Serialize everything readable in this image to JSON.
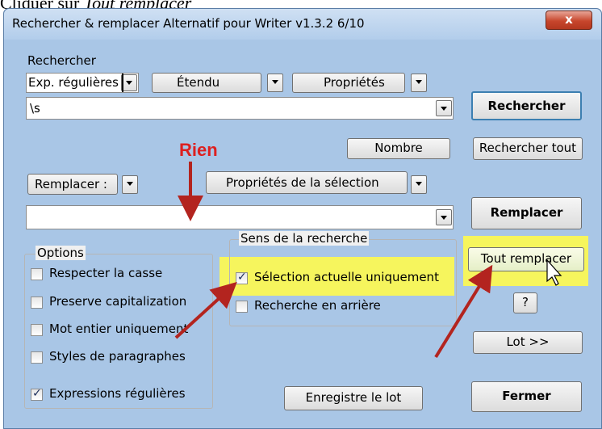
{
  "caption": {
    "prefix": "Cliquer sur ",
    "emphasis": "Tout remplacer"
  },
  "window": {
    "title": "Rechercher & remplacer Alternatif pour Writer v1.3.2  6/10",
    "close_label": "x"
  },
  "search": {
    "label": "Rechercher",
    "mode_selected": "Exp. régulières",
    "extended_label": "Étendu",
    "properties_label": "Propriétés",
    "value": "\\s",
    "count_button": "Nombre"
  },
  "replace": {
    "mode_selected": "Remplacer :",
    "selection_properties_button": "Propriétés de la sélection",
    "value": ""
  },
  "options": {
    "legend": "Options",
    "items": [
      {
        "label": "Respecter la casse",
        "checked": false
      },
      {
        "label": "Preserve capitalization",
        "checked": false
      },
      {
        "label": "Mot entier uniquement",
        "checked": false
      },
      {
        "label": "Styles de paragraphes",
        "checked": false
      },
      {
        "label": "Expressions régulières",
        "checked": true
      }
    ]
  },
  "direction": {
    "legend": "Sens de la recherche",
    "items": [
      {
        "label": "Sélection actuelle uniquement",
        "checked": true
      },
      {
        "label": "Recherche en arrière",
        "checked": false
      }
    ]
  },
  "buttons": {
    "search": "Rechercher",
    "search_all": "Rechercher tout",
    "replace": "Remplacer",
    "replace_all": "Tout remplacer",
    "help": "?",
    "batch": "Lot >>",
    "save_batch": "Enregistre le lot",
    "close": "Fermer"
  },
  "annotation": {
    "text": "Rien"
  },
  "colors": {
    "highlight": "#f6f55d",
    "annotation": "#dd2020",
    "arrow": "#b3241f"
  }
}
